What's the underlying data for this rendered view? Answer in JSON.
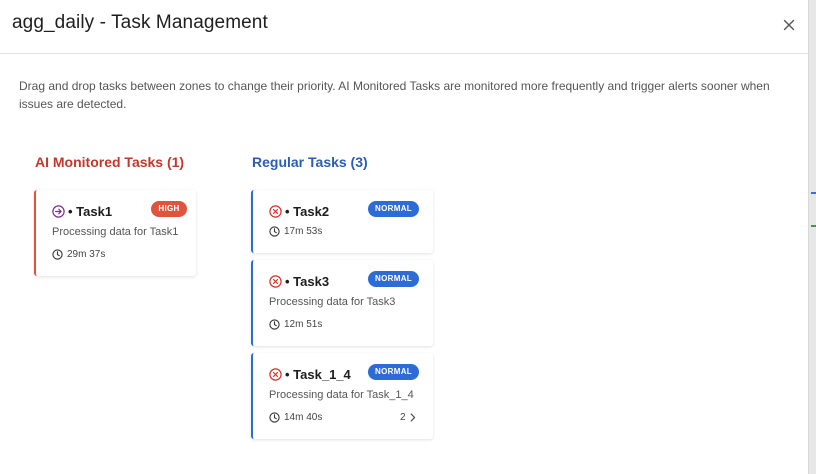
{
  "dialog": {
    "title": "agg_daily - Task Management",
    "description": "Drag and drop tasks between zones to change their priority. AI Monitored Tasks are monitored more frequently and trigger alerts sooner when issues are detected."
  },
  "columns": {
    "ai": {
      "title": "AI Monitored Tasks (1)",
      "tasks": [
        {
          "name": "Task1",
          "priority": "HIGH",
          "description": "Processing data for Task1",
          "duration": "29m 37s",
          "status_icon": "arrow-circle-icon"
        }
      ]
    },
    "regular": {
      "title": "Regular Tasks (3)",
      "tasks": [
        {
          "name": "Task2",
          "priority": "NORMAL",
          "duration": "17m 53s",
          "status_icon": "x-circle-icon"
        },
        {
          "name": "Task3",
          "priority": "NORMAL",
          "description": "Processing data for Task3",
          "duration": "12m 51s",
          "status_icon": "x-circle-icon"
        },
        {
          "name": "Task_1_4",
          "priority": "NORMAL",
          "description": "Processing data for Task_1_4",
          "duration": "14m 40s",
          "status_icon": "x-circle-icon",
          "count": "2"
        }
      ]
    }
  },
  "colors": {
    "ai_accent": "#e0533f",
    "ai_title": "#c0392b",
    "regular_accent": "#2d6cd6",
    "regular_title": "#2b5db3",
    "arrow_icon": "#7b2d8e",
    "error_icon": "#d93025"
  }
}
